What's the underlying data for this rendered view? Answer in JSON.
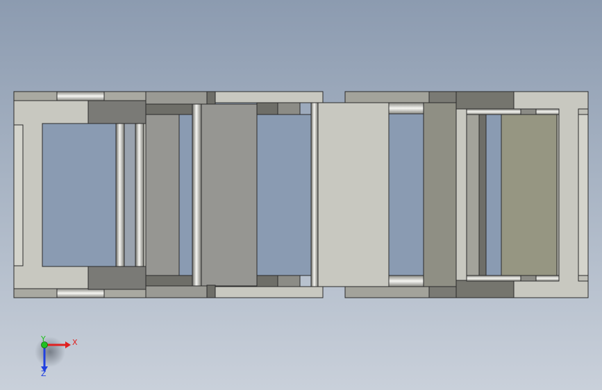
{
  "viewport": {
    "model": "cable-drag-chain-assembly-top-view",
    "background_top": "#8c9bb0",
    "background_bottom": "#c9d0da"
  },
  "colors": {
    "frame_light": "#c8c8c0",
    "frame_mid": "#a3a39b",
    "frame_dark": "#7a7a74",
    "plate_gray": "#969692",
    "plate_green": "#8f8f84",
    "edge": "#2a2a2a",
    "pin_highlight": "#f4f4f0"
  },
  "triad": {
    "x_label": "X",
    "y_label": "Y",
    "z_label": "Z",
    "x_color": "#e02020",
    "y_color": "#20c020",
    "z_color": "#2040e0"
  }
}
